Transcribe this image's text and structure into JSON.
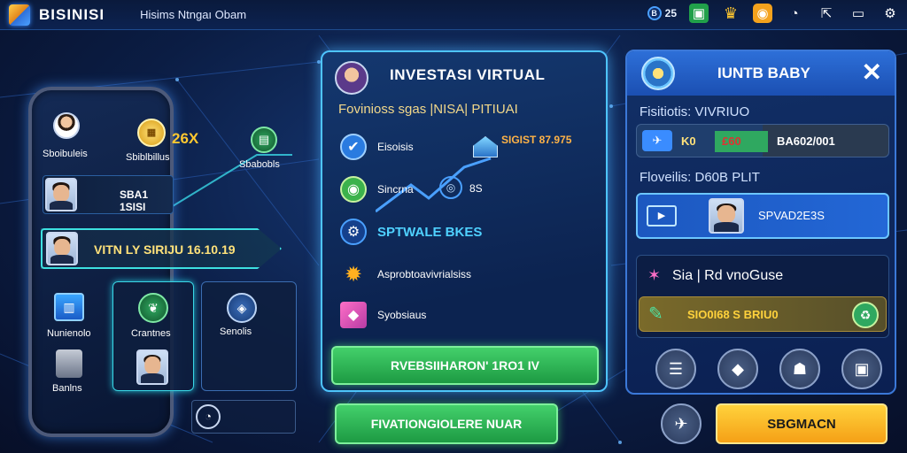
{
  "topbar": {
    "brand": "BISINISI",
    "subtitle": "Hisims Ntngaı Obam",
    "coins": "25"
  },
  "phone": {
    "top_left_label": "Sboibuleis",
    "top_mid_label": "Sbiblbillus",
    "multiplier": "26X",
    "top_right_label": "Sbabobls",
    "row1_text": "SBA1 1SISI",
    "row2_text": "VITN LY SIRIJU 16.10.19",
    "tile1_label": "Nunienolo",
    "tile2_label": "Crantnes",
    "tile3_label": "Senolis",
    "tile4_label": "Banlns"
  },
  "center": {
    "title": "INVESTASI VIRTUAL",
    "subtitle": "Fovinioss sgas |NISA| PITIUAI",
    "items": [
      {
        "label": "Eisoisis"
      },
      {
        "label": "Sincrna"
      },
      {
        "label": "SPTWALE BKES"
      },
      {
        "label": "Asprobtoavivrialsiss"
      },
      {
        "label": "Syobsiaus"
      }
    ],
    "value_1": "SIGIST 87.975",
    "value_2": "8S",
    "main_button": "RVEBSIIHARON' 1RO1 IV",
    "lower_button": "FIVATIONGIOLERE NUAR"
  },
  "right": {
    "title": "IUNTB BABY",
    "label1": "Fisitiotis: VIVRIUO",
    "row1_left": "K0",
    "row1_mid": "£60",
    "row1_right": "BA602/001",
    "label2": "Floveilis: D60B PLIT",
    "person_text": "SPVAD2E3S",
    "label3": "Sia | Rd vnoGuse",
    "highlight_text": "SIO0I68 S BRIU0",
    "action_button": "SBGMACN"
  },
  "colors": {
    "accent": "#4ec4ff",
    "green": "#2fbd57",
    "gold": "#ffc830",
    "panel": "#0c2350"
  }
}
